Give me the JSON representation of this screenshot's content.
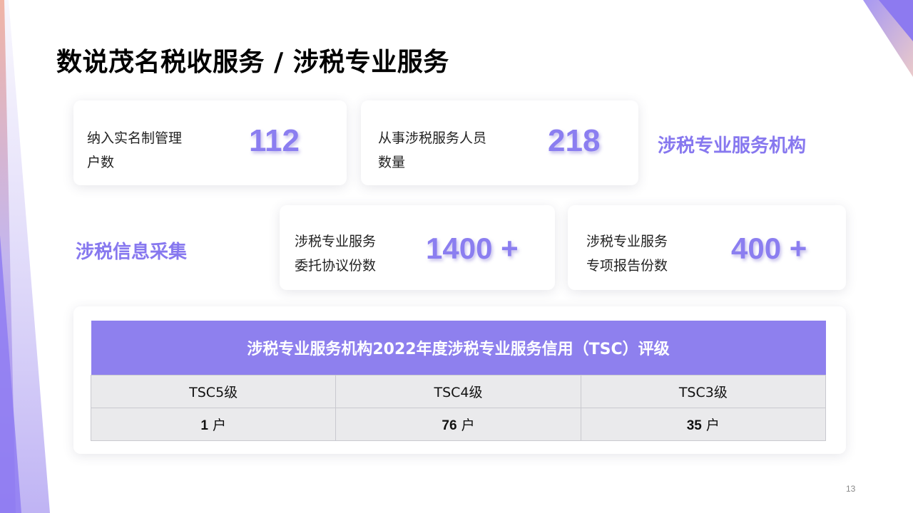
{
  "slide": {
    "title": "数说茂名税收服务 / 涉税专业服务",
    "page_number": "13"
  },
  "cards": {
    "registered": {
      "label_line1": "纳入实名制管理",
      "label_line2": "户数",
      "value": "112"
    },
    "personnel": {
      "label_line1": "从事涉税服务人员",
      "label_line2": "数量",
      "value": "218"
    },
    "agreements": {
      "label_line1": "涉税专业服务",
      "label_line2": "委托协议份数",
      "value": "1400 +"
    },
    "reports": {
      "label_line1": "涉税专业服务",
      "label_line2": "专项报告份数",
      "value": "400 +"
    }
  },
  "sections": {
    "institutions": "涉税专业服务机构",
    "info_collection": "涉税信息采集"
  },
  "table": {
    "title": "涉税专业服务机构2022年度涉税专业服务信用（TSC）评级",
    "columns": [
      "TSC5级",
      "TSC4级",
      "TSC3级"
    ],
    "counts": [
      "1",
      "76",
      "35"
    ],
    "unit": "户"
  },
  "colors": {
    "accent": "#8b7ef0",
    "table_header": "#8e80ee",
    "table_cell": "#eaeaec"
  }
}
